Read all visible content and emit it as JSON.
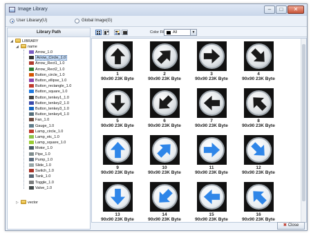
{
  "window": {
    "title": "Image Library",
    "min": "–",
    "max": "□",
    "close": "✕"
  },
  "source": {
    "user": "User Libarary(U)",
    "global": "Global Image(G)"
  },
  "sidebar": {
    "header": "Library Path",
    "root": "LIBRARY",
    "folder": "name",
    "items": [
      "Arrow_1.0",
      "Arrow_Circle_1.0",
      "Arrow_Rect1_1.0",
      "Arrow_Rect2_1.0",
      "Button_circle_1.0",
      "Button_ellipse_1.0",
      "Button_rectangle_1.0",
      "Button_square_1.0",
      "Button_tenkey1_1.0",
      "Button_tenkey2_1.0",
      "Button_tenkey3_1.0",
      "Button_tenkey4_1.0",
      "Fan_1.0",
      "Gauge_1.0",
      "Lamp_circle_1.0",
      "Lamp_etc_1.0",
      "Lamp_square_1.0",
      "Motor_1.0",
      "Pipe_1.0",
      "Pump_1.0",
      "Slide_1.0",
      "Switch_1.0",
      "Tank_1.0",
      "Toggle_1.0",
      "Valve_1.0"
    ],
    "selected_index": 1,
    "vector": "vector"
  },
  "filter": {
    "label": "Color Filter",
    "value": "All"
  },
  "grid": {
    "tiles": [
      {
        "num": "1",
        "info": "90x90 23K Byte",
        "style": "black",
        "dir": 0
      },
      {
        "num": "2",
        "info": "90x90 23K Byte",
        "style": "black",
        "dir": 45
      },
      {
        "num": "3",
        "info": "90x90 23K Byte",
        "style": "black",
        "dir": 90
      },
      {
        "num": "4",
        "info": "90x90 23K Byte",
        "style": "black",
        "dir": 135
      },
      {
        "num": "5",
        "info": "90x90 23K Byte",
        "style": "black",
        "dir": 180
      },
      {
        "num": "6",
        "info": "90x90 23K Byte",
        "style": "black",
        "dir": 225
      },
      {
        "num": "7",
        "info": "90x90 23K Byte",
        "style": "black",
        "dir": 270
      },
      {
        "num": "8",
        "info": "90x90 23K Byte",
        "style": "black",
        "dir": 315
      },
      {
        "num": "9",
        "info": "90x90 23K Byte",
        "style": "blue",
        "dir": 0
      },
      {
        "num": "10",
        "info": "90x90 23K Byte",
        "style": "blue",
        "dir": 45
      },
      {
        "num": "11",
        "info": "90x90 23K Byte",
        "style": "blue",
        "dir": 90
      },
      {
        "num": "12",
        "info": "90x90 23K Byte",
        "style": "blue",
        "dir": 135
      },
      {
        "num": "13",
        "info": "90x90 23K Byte",
        "style": "blue",
        "dir": 180
      },
      {
        "num": "14",
        "info": "90x90 23K Byte",
        "style": "blue",
        "dir": 225
      },
      {
        "num": "15",
        "info": "90x90 23K Byte",
        "style": "blue",
        "dir": 270
      },
      {
        "num": "16",
        "info": "90x90 23K Byte",
        "style": "blue",
        "dir": 315
      }
    ]
  },
  "footer": {
    "close": "Close"
  },
  "colors": {
    "arrow_black": "#1a1a1a",
    "arrow_blue": "#2f86e8",
    "selection": "#c4dbf6"
  }
}
